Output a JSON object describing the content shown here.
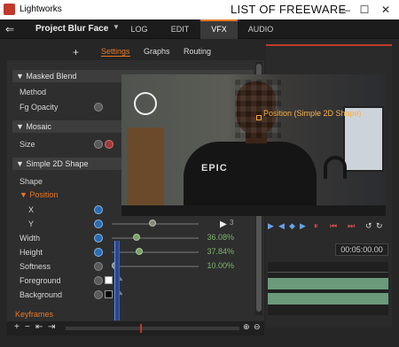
{
  "window": {
    "app_title": "Lightworks",
    "center_caption": "LIST OF FREEWARE",
    "minimize": "—",
    "maximize": "☐",
    "close": "✕"
  },
  "nav": {
    "exit_icon": "exit-icon",
    "project": "Project Blur Face",
    "dropdown": "▼",
    "tabs": [
      {
        "label": "LOG"
      },
      {
        "label": "EDIT"
      },
      {
        "label": "VFX",
        "active": true
      },
      {
        "label": "AUDIO"
      }
    ]
  },
  "panel": {
    "add": "+",
    "subtabs": [
      {
        "label": "Settings",
        "active": true
      },
      {
        "label": "Graphs"
      },
      {
        "label": "Routing"
      }
    ],
    "sections": {
      "masked_blend": "▼ Masked Blend",
      "mosaic": "▼ Mosaic",
      "shape": "▼ Simple 2D Shape"
    },
    "rows": {
      "method": "Method",
      "fg_opacity": "Fg Opacity",
      "size": "Size",
      "shape": "Shape",
      "position": "▼ Position",
      "x": "X",
      "y": "Y",
      "width": "Width",
      "height": "Height",
      "softness": "Softness",
      "foreground": "Foreground",
      "background": "Background"
    },
    "values": {
      "y_kf": "3",
      "width": "36.08%",
      "height": "37.84%",
      "softness": "10.00%"
    },
    "sliders": {
      "width": 0.36,
      "height": 0.38,
      "softness": 0.1,
      "y": 0.5
    },
    "swatches": {
      "foreground": "#ffffff",
      "background": "#000000"
    }
  },
  "keyframes": {
    "label": "Keyframes",
    "add": "+",
    "remove": "−",
    "prev": "⇤",
    "next": "⇥"
  },
  "viewer": {
    "overlay_label": "Position (Simple 2D Shape)",
    "shirt_text": "EPIC",
    "timecode": "00:05:00.00",
    "transport": [
      "▶",
      "◀",
      "◆",
      "▶",
      "⏸",
      "⏮",
      "⏭",
      "↺",
      "↻"
    ]
  },
  "colors": {
    "accent": "#e87722",
    "value_green": "#7fb36a",
    "blue": "#2b6cb0"
  }
}
